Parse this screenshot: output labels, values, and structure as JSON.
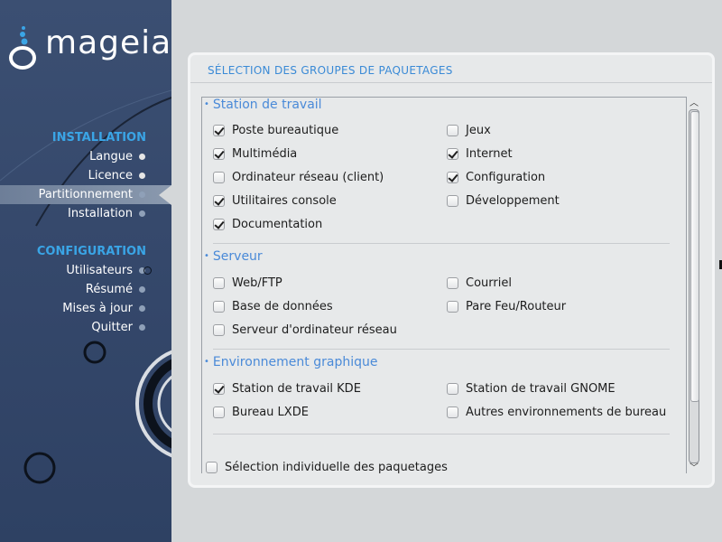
{
  "sidebar": {
    "logo_text": "mageia",
    "sections": [
      {
        "label": "INSTALLATION"
      },
      {
        "label": "CONFIGURATION"
      }
    ],
    "installation_items": [
      {
        "label": "Langue"
      },
      {
        "label": "Licence"
      },
      {
        "label": "Partitionnement"
      },
      {
        "label": "Installation"
      }
    ],
    "configuration_items": [
      {
        "label": "Utilisateurs"
      },
      {
        "label": "Résumé"
      },
      {
        "label": "Mises à jour"
      },
      {
        "label": "Quitter"
      }
    ],
    "active_item": "Partitionnement"
  },
  "panel": {
    "title": "SÉLECTION DES GROUPES DE PAQUETAGES",
    "groups": [
      {
        "title": "Station de travail",
        "options": [
          {
            "label": "Poste bureautique",
            "checked": true
          },
          {
            "label": "Jeux",
            "checked": false
          },
          {
            "label": "Multimédia",
            "checked": true
          },
          {
            "label": "Internet",
            "checked": true
          },
          {
            "label": "Ordinateur réseau (client)",
            "checked": false
          },
          {
            "label": "Configuration",
            "checked": true
          },
          {
            "label": "Utilitaires console",
            "checked": true
          },
          {
            "label": "Développement",
            "checked": false
          },
          {
            "label": "Documentation",
            "checked": true
          }
        ]
      },
      {
        "title": "Serveur",
        "options": [
          {
            "label": "Web/FTP",
            "checked": false
          },
          {
            "label": "Courriel",
            "checked": false
          },
          {
            "label": "Base de données",
            "checked": false
          },
          {
            "label": "Pare Feu/Routeur",
            "checked": false
          },
          {
            "label": "Serveur d'ordinateur réseau",
            "checked": false
          }
        ]
      },
      {
        "title": "Environnement graphique",
        "options": [
          {
            "label": "Station de travail KDE",
            "checked": true
          },
          {
            "label": "Station de travail GNOME",
            "checked": false
          },
          {
            "label": "Bureau LXDE",
            "checked": false
          },
          {
            "label": "Autres environnements de bureau",
            "checked": false
          }
        ]
      }
    ],
    "individual_selection": {
      "label": "Sélection individuelle des paquetages",
      "checked": false
    }
  },
  "colors": {
    "sidebar_bg": "#34476a",
    "section_accent": "#3aa5e6",
    "group_title": "#4a8ad8",
    "panel_bg": "#e7e9ea"
  }
}
